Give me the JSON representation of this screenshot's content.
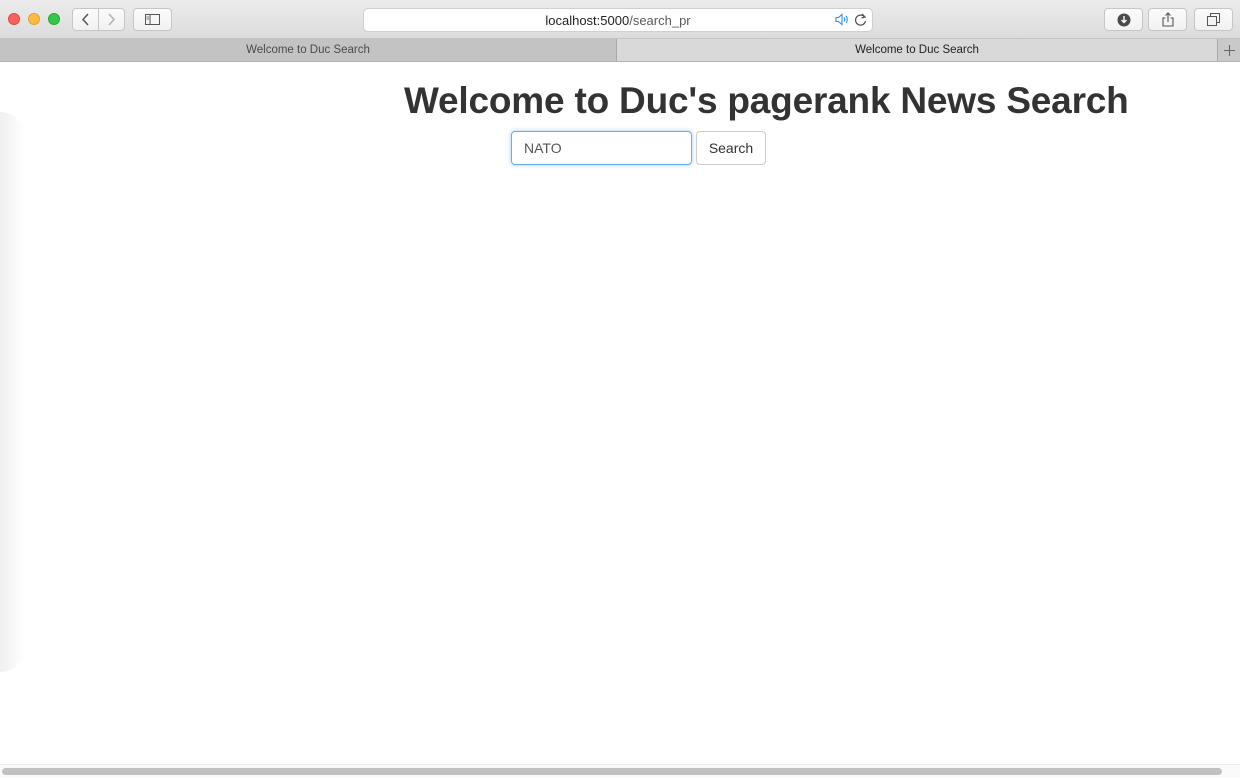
{
  "browser": {
    "url_host": "localhost:5000",
    "url_path": "/search_pr",
    "tabs": [
      {
        "label": "Welcome to Duc Search"
      },
      {
        "label": "Welcome to Duc Search"
      }
    ]
  },
  "icons": {
    "back": "chevron-left-icon",
    "forward": "chevron-right-icon",
    "sidebar": "sidebar-icon",
    "audio": "speaker-icon",
    "reload": "reload-icon",
    "download": "download-icon",
    "share": "share-icon",
    "tabs": "tabs-overview-icon",
    "new_tab": "plus-icon"
  },
  "colors": {
    "focus_border": "#66afe9",
    "title_text": "#333333",
    "audio_icon": "#2d8ef0"
  },
  "main": {
    "title": "Welcome to Duc's pagerank News Search",
    "search": {
      "value": "NATO",
      "button_label": "Search"
    }
  }
}
